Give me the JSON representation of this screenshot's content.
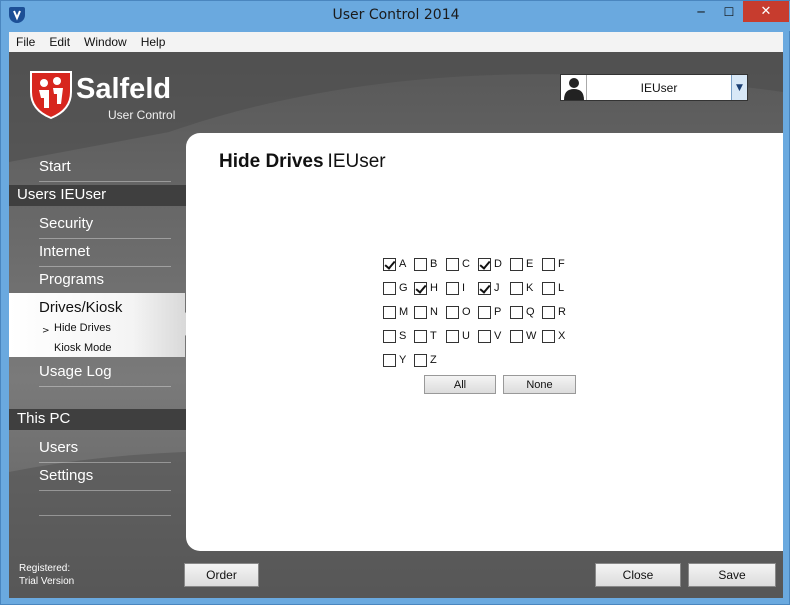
{
  "window": {
    "title": "User Control 2014",
    "minimize_glyph": "─",
    "maximize_glyph": "☐",
    "close_glyph": "✕"
  },
  "menu": [
    "File",
    "Edit",
    "Window",
    "Help"
  ],
  "logo": {
    "brand": "Salfeld",
    "product": "User Control"
  },
  "user_select": {
    "value": "IEUser",
    "arrow": "▼"
  },
  "sidebar": {
    "start": "Start",
    "users_header": "Users IEUser",
    "security": "Security",
    "internet": "Internet",
    "programs": "Programs",
    "drives_kiosk": "Drives/Kiosk",
    "sub_arrow": ">",
    "hide_drives": "Hide Drives",
    "kiosk_mode": "Kiosk Mode",
    "usage_log": "Usage Log",
    "this_pc_header": "This PC",
    "users": "Users",
    "settings": "Settings"
  },
  "registration": {
    "line1": "Registered:",
    "line2": "Trial Version"
  },
  "content": {
    "title": "Hide Drives",
    "user": "IEUser",
    "drives": [
      {
        "letter": "A",
        "checked": true
      },
      {
        "letter": "B",
        "checked": false
      },
      {
        "letter": "C",
        "checked": false
      },
      {
        "letter": "D",
        "checked": true
      },
      {
        "letter": "E",
        "checked": false
      },
      {
        "letter": "F",
        "checked": false
      },
      {
        "letter": "G",
        "checked": false
      },
      {
        "letter": "H",
        "checked": true
      },
      {
        "letter": "I",
        "checked": false
      },
      {
        "letter": "J",
        "checked": true
      },
      {
        "letter": "K",
        "checked": false
      },
      {
        "letter": "L",
        "checked": false
      },
      {
        "letter": "M",
        "checked": false
      },
      {
        "letter": "N",
        "checked": false
      },
      {
        "letter": "O",
        "checked": false
      },
      {
        "letter": "P",
        "checked": false
      },
      {
        "letter": "Q",
        "checked": false
      },
      {
        "letter": "R",
        "checked": false
      },
      {
        "letter": "S",
        "checked": false
      },
      {
        "letter": "T",
        "checked": false
      },
      {
        "letter": "U",
        "checked": false
      },
      {
        "letter": "V",
        "checked": false
      },
      {
        "letter": "W",
        "checked": false
      },
      {
        "letter": "X",
        "checked": false
      },
      {
        "letter": "Y",
        "checked": false
      },
      {
        "letter": "Z",
        "checked": false
      }
    ],
    "all_button": "All",
    "none_button": "None"
  },
  "buttons": {
    "order": "Order",
    "close": "Close",
    "save": "Save"
  },
  "colors": {
    "titlebar": "#6aa9df",
    "close_button": "#c73c2e",
    "sidebar_bg": "#666666",
    "section_header": "#3f3f3f",
    "logo_red": "#d7261e"
  }
}
